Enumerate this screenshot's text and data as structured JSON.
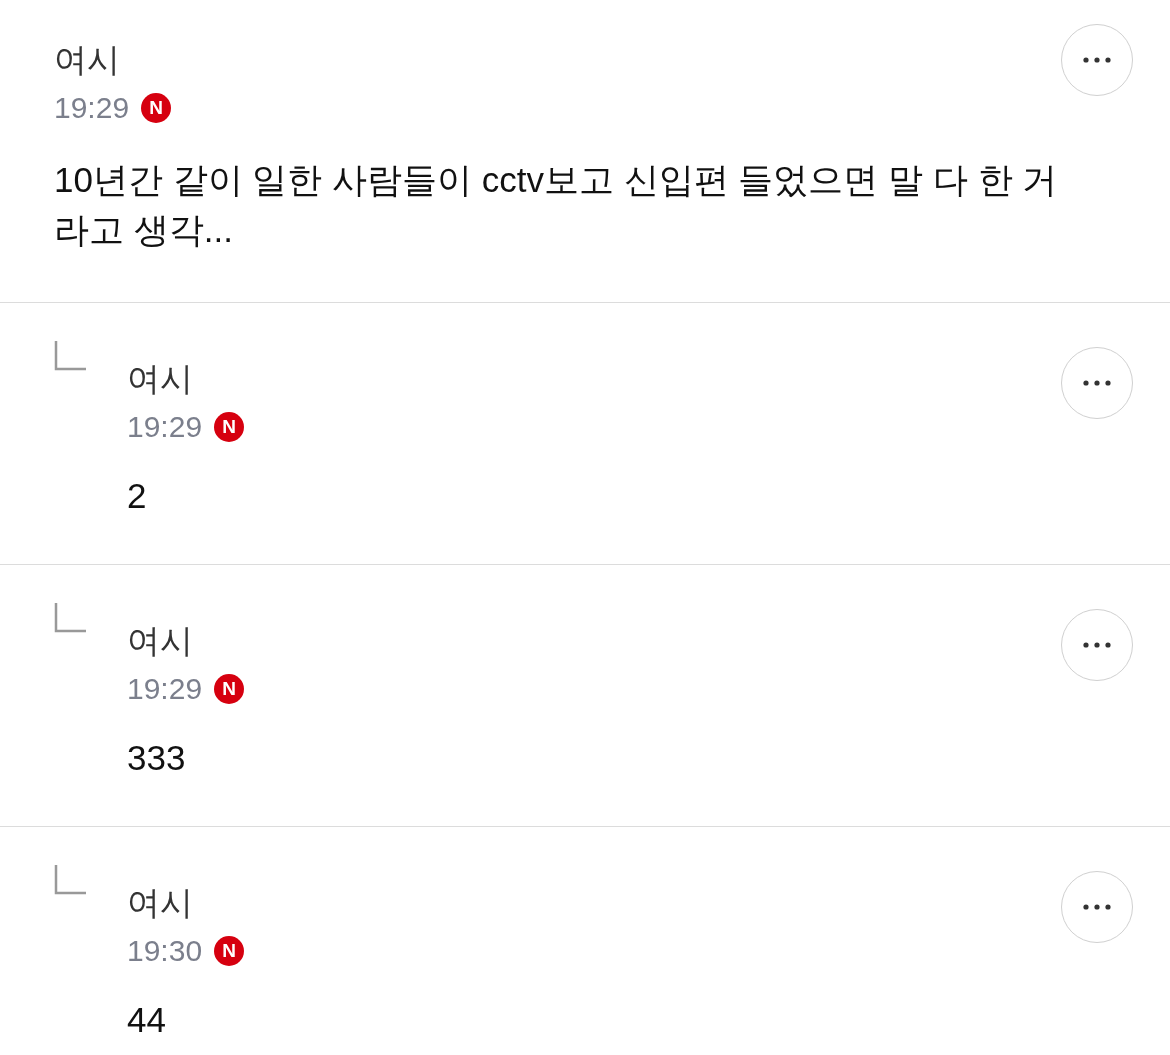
{
  "comments": [
    {
      "kind": "comment",
      "author": "여시",
      "time": "19:29",
      "badge": "N",
      "body": "10년간 같이 일한 사람들이 cctv보고 신입편 들었으면 말 다 한 거라고 생각..."
    },
    {
      "kind": "reply",
      "author": "여시",
      "time": "19:29",
      "badge": "N",
      "body": "2"
    },
    {
      "kind": "reply",
      "author": "여시",
      "time": "19:29",
      "badge": "N",
      "body": "333"
    },
    {
      "kind": "reply",
      "author": "여시",
      "time": "19:30",
      "badge": "N",
      "body": "44"
    }
  ]
}
